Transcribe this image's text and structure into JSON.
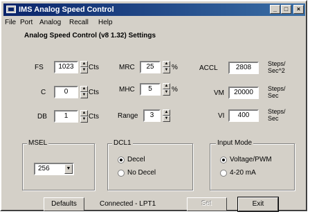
{
  "window": {
    "title": "IMS Analog Speed Control"
  },
  "title_buttons": {
    "minimize": "_",
    "maximize": "□",
    "close": "×"
  },
  "menu": [
    "File",
    "Port",
    "Analog",
    "Recall",
    "Help"
  ],
  "section_title": "Analog Speed Control (v8 1.32) Settings",
  "params": {
    "fs": {
      "label": "FS",
      "value": "1023",
      "unit": "Cts"
    },
    "c": {
      "label": "C",
      "value": "0",
      "unit": "Cts"
    },
    "db": {
      "label": "DB",
      "value": "1",
      "unit": "Cts"
    },
    "mrc": {
      "label": "MRC",
      "value": "25",
      "unit": "%"
    },
    "mhc": {
      "label": "MHC",
      "value": "5",
      "unit": "%"
    },
    "range": {
      "label": "Range",
      "value": "3"
    },
    "accl": {
      "label": "ACCL",
      "value": "2808",
      "unit1": "Steps/",
      "unit2": "Sec^2"
    },
    "vm": {
      "label": "VM",
      "value": "20000",
      "unit1": "Steps/",
      "unit2": "Sec"
    },
    "vi": {
      "label": "VI",
      "value": "400",
      "unit1": "Steps/",
      "unit2": "Sec"
    }
  },
  "msel": {
    "label": "MSEL",
    "value": "256"
  },
  "dcl1": {
    "label": "DCL1",
    "options": [
      "Decel",
      "No Decel"
    ],
    "selected": 0
  },
  "input_mode": {
    "label": "Input Mode",
    "options": [
      "Voltage/PWM",
      "4-20 mA"
    ],
    "selected": 0
  },
  "footer": {
    "defaults": "Defaults",
    "status": "Connected - LPT1",
    "set": "Set",
    "exit": "Exit"
  }
}
